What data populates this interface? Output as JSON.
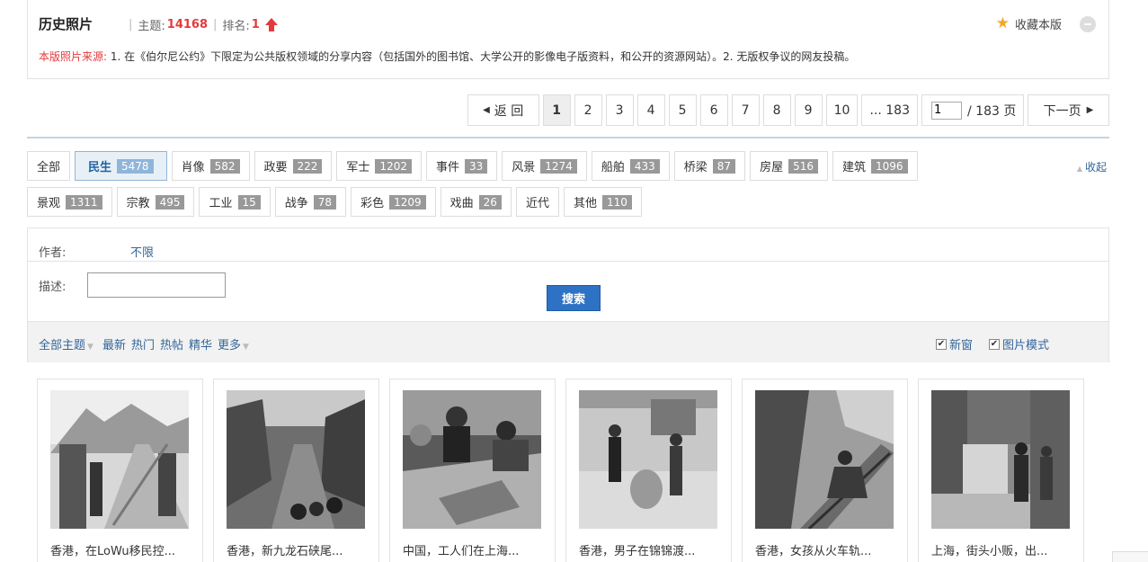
{
  "forum": {
    "title": "历史照片",
    "topics_label": "主题:",
    "topics_count": "14168",
    "rank_label": "排名:",
    "rank_value": "1",
    "favorite_label": "收藏本版",
    "source_label": "本版照片来源:",
    "source_text": "1. 在《伯尔尼公约》下限定为公共版权领域的分享内容（包括国外的图书馆、大学公开的影像电子版资料，和公开的资源网站）。2. 无版权争议的网友投稿。"
  },
  "pager": {
    "back_label": "返 回",
    "pages": [
      "1",
      "2",
      "3",
      "4",
      "5",
      "6",
      "7",
      "8",
      "9",
      "10"
    ],
    "current": "1",
    "last_label": "... 183",
    "jump_value": "1",
    "total_label": "/ 183 页",
    "next_label": "下一页"
  },
  "types": {
    "row1": [
      {
        "label": "全部",
        "count": ""
      },
      {
        "label": "民生",
        "count": "5478"
      },
      {
        "label": "肖像",
        "count": "582"
      },
      {
        "label": "政要",
        "count": "222"
      },
      {
        "label": "军士",
        "count": "1202"
      },
      {
        "label": "事件",
        "count": "33"
      },
      {
        "label": "风景",
        "count": "1274"
      },
      {
        "label": "船舶",
        "count": "433"
      },
      {
        "label": "桥梁",
        "count": "87"
      },
      {
        "label": "房屋",
        "count": "516"
      },
      {
        "label": "建筑",
        "count": "1096"
      }
    ],
    "row2": [
      {
        "label": "景观",
        "count": "1311"
      },
      {
        "label": "宗教",
        "count": "495"
      },
      {
        "label": "工业",
        "count": "15"
      },
      {
        "label": "战争",
        "count": "78"
      },
      {
        "label": "彩色",
        "count": "1209"
      },
      {
        "label": "戏曲",
        "count": "26"
      },
      {
        "label": "近代",
        "count": ""
      },
      {
        "label": "其他",
        "count": "110"
      }
    ],
    "collapse_label": "收起"
  },
  "search": {
    "author_label": "作者:",
    "author_value": "不限",
    "desc_label": "描述:",
    "desc_value": "",
    "button_label": "搜索"
  },
  "filter_bar": {
    "all_topics": "全部主题",
    "latest": "最新",
    "hot": "热门",
    "hot_posts": "热帖",
    "digest": "精华",
    "more": "更多",
    "new_window": "新窗",
    "picture_mode": "图片模式"
  },
  "photos": [
    {
      "caption": "香港，在LoWu移民控..."
    },
    {
      "caption": "香港，新九龙石硖尾..."
    },
    {
      "caption": "中国，工人们在上海..."
    },
    {
      "caption": "香港，男子在锦锦渡..."
    },
    {
      "caption": "香港，女孩从火车轨..."
    },
    {
      "caption": "上海，街头小贩，出..."
    }
  ],
  "colors": {
    "accent_red": "#e4393c",
    "link_blue": "#336699",
    "button_blue": "#2d72c5"
  }
}
